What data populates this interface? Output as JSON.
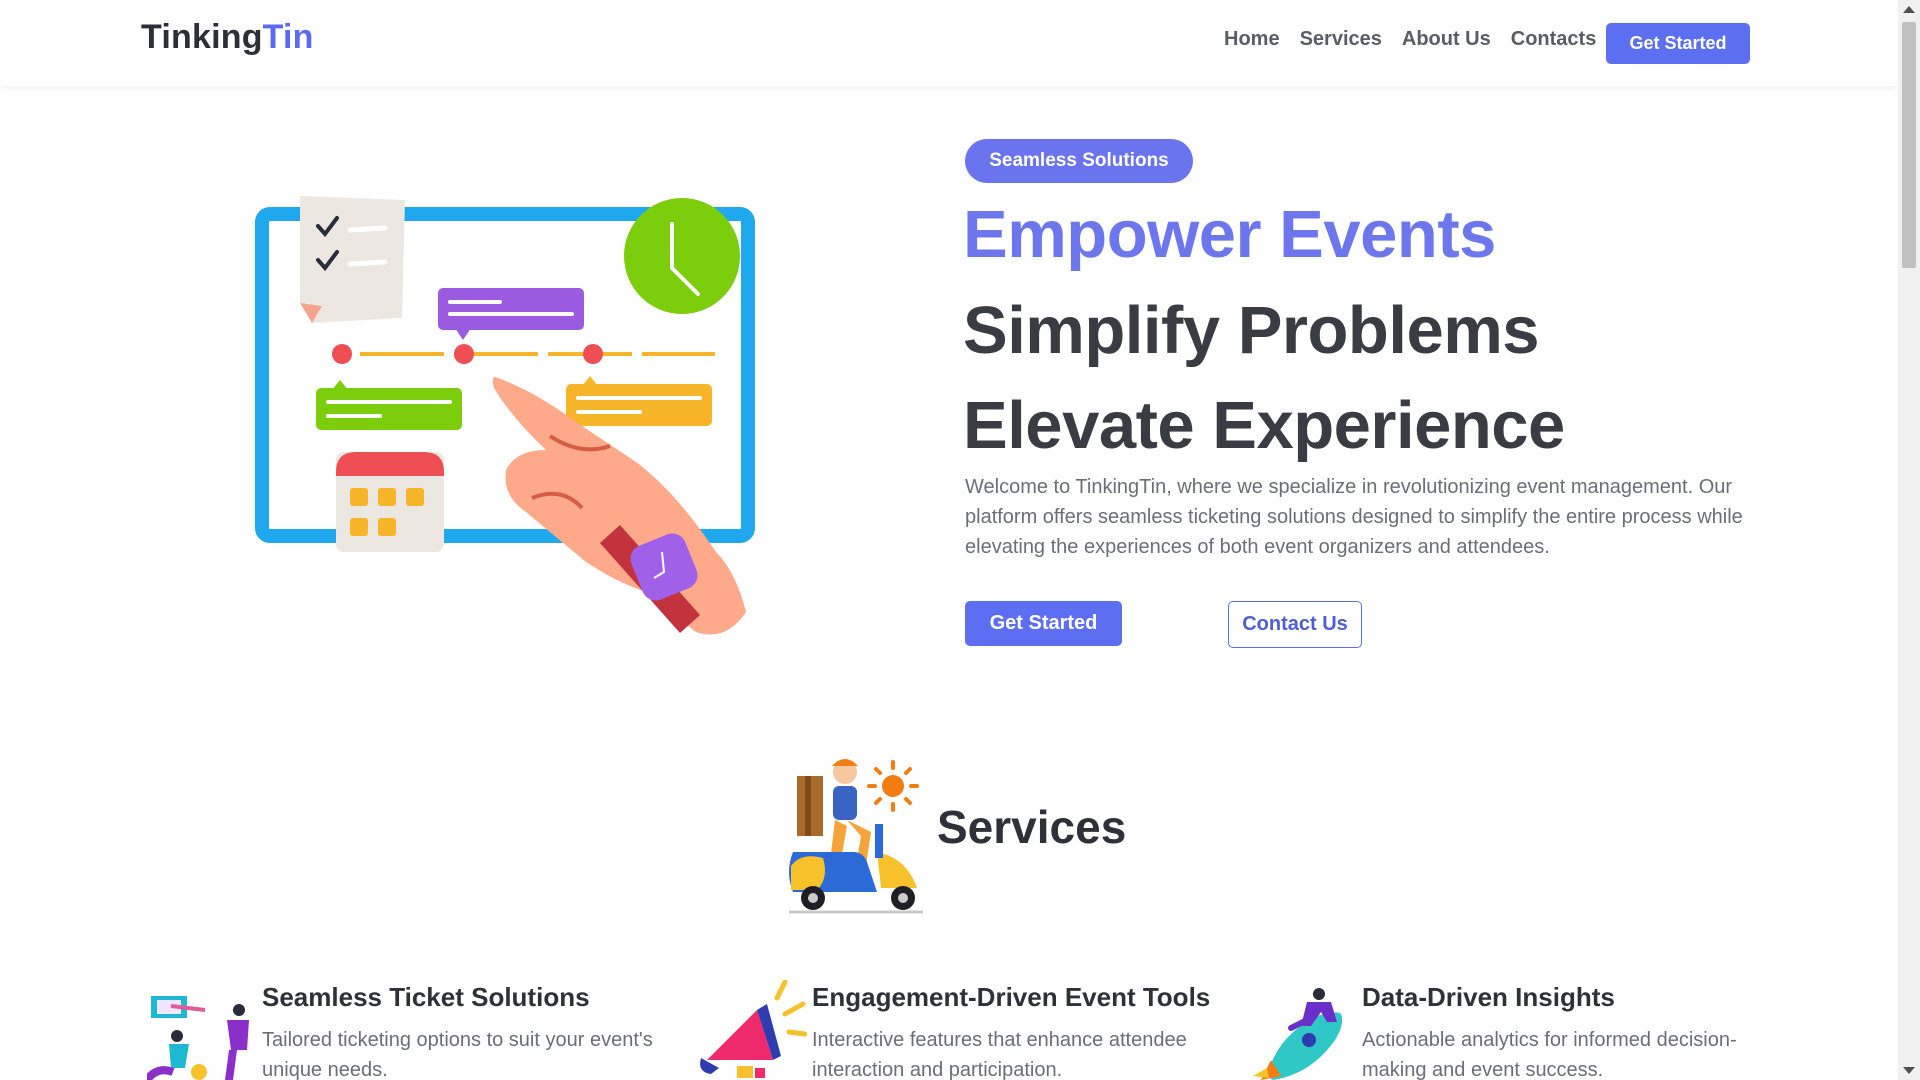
{
  "header": {
    "logo_part1": "Tinking",
    "logo_part2": "Tin",
    "nav": [
      "Home",
      "Services",
      "About Us",
      "Contacts"
    ],
    "cta": "Get Started"
  },
  "hero": {
    "badge": "Seamless Solutions",
    "headline1": "Empower Events",
    "headline2": "Simplify Problems",
    "headline3": "Elevate Experience",
    "intro": "Welcome to TinkingTin, where we specialize in revolutionizing event management. Our platform offers seamless ticketing solutions designed to simplify the entire process while elevating the experiences of both event organizers and attendees.",
    "primary_button": "Get Started",
    "secondary_button": "Contact Us"
  },
  "services": {
    "title": "Services",
    "cards": [
      {
        "title": "Seamless Ticket Solutions",
        "desc": "Tailored ticketing options to suit your event's unique needs."
      },
      {
        "title": "Engagement-Driven Event Tools",
        "desc": "Interactive features that enhance attendee interaction and participation."
      },
      {
        "title": "Data-Driven Insights",
        "desc": "Actionable analytics for informed decision-making and event success."
      }
    ]
  },
  "colors": {
    "accent": "#5c6ef2",
    "headline_accent": "#6c77ee",
    "text_dark": "#3a3c43",
    "text_muted": "#6b6e77"
  },
  "icons": [
    "calendar-dashboard-illustration",
    "delivery-scooter-illustration",
    "team-illustration",
    "megaphone-illustration",
    "rocket-illustration"
  ]
}
